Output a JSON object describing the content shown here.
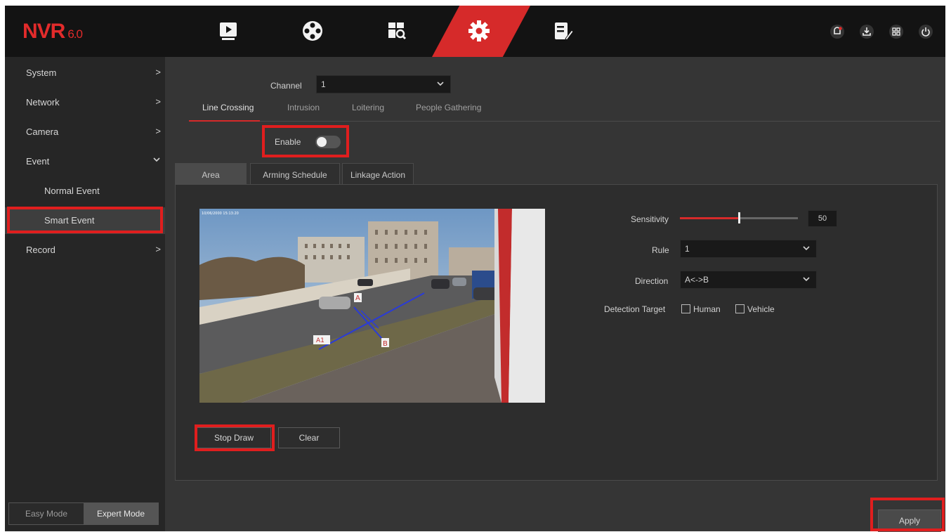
{
  "header": {
    "logo": "NVR",
    "version": "6.0",
    "nav": [
      {
        "icon": "playback-icon"
      },
      {
        "icon": "channel-reel-icon"
      },
      {
        "icon": "search-icon"
      },
      {
        "icon": "settings-gear-icon",
        "active": true
      },
      {
        "icon": "maintenance-icon"
      }
    ],
    "right_icons": [
      "alarm-icon",
      "download-icon",
      "layout-icon",
      "power-icon"
    ]
  },
  "sidebar": {
    "items": [
      {
        "label": "System",
        "chevron": ">"
      },
      {
        "label": "Network",
        "chevron": ">"
      },
      {
        "label": "Camera",
        "chevron": ">"
      },
      {
        "label": "Event",
        "chevron": "v"
      },
      {
        "label": "Normal Event"
      },
      {
        "label": "Smart Event",
        "selected": true
      },
      {
        "label": "Record",
        "chevron": ">"
      }
    ],
    "modes": {
      "easy": "Easy Mode",
      "expert": "Expert Mode",
      "active": "Expert Mode"
    }
  },
  "main": {
    "channel_label": "Channel",
    "channel_value": "1",
    "tabs": [
      "Line Crossing",
      "Intrusion",
      "Loitering",
      "People Gathering"
    ],
    "active_tab": "Line Crossing",
    "enable_label": "Enable",
    "enable_on": false,
    "subtabs": [
      "Area",
      "Arming Schedule",
      "Linkage Action"
    ],
    "active_subtab": "Area",
    "preview_timestamp": "10/06/2000 15:13:20",
    "line_labels": {
      "a": "A",
      "b": "B",
      "line": "A1"
    },
    "stop_draw": "Stop Draw",
    "clear": "Clear",
    "sensitivity_label": "Sensitivity",
    "sensitivity_value": "50",
    "sensitivity_fraction": 0.5,
    "rule_label": "Rule",
    "rule_value": "1",
    "direction_label": "Direction",
    "direction_value": "A<->B",
    "detection_label": "Detection Target",
    "human_label": "Human",
    "vehicle_label": "Vehicle",
    "apply": "Apply"
  },
  "colors": {
    "accent": "#d62a2a",
    "header_bg": "#131313",
    "sidebar_bg": "#262626",
    "main_bg": "#353535",
    "highlight_box": "#e01e1e"
  }
}
